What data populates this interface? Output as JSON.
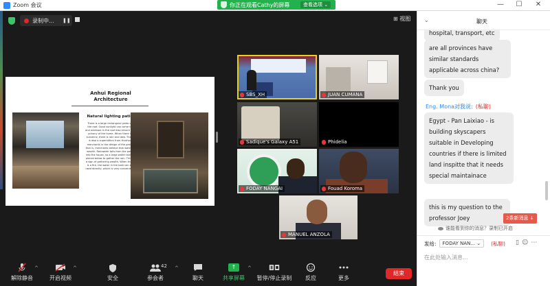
{
  "window": {
    "title": "Zoom 会议",
    "minimize": "—",
    "maximize": "☐",
    "close": "✕"
  },
  "share_banner": {
    "text": "你正在观看Cathy的屏幕",
    "view_options": "查看选项 ⌄"
  },
  "recording": {
    "label": "录制中...",
    "pause": "❚❚",
    "stop": "■"
  },
  "view_button": "⊞ 视图",
  "slide": {
    "title": "Anhui Regional Architecture",
    "subtitle": "Natural lighting patio",
    "body": "There is a large rectangular patio on the roof. Good sunlight can come in, and windows in the roof also ensure the privacy of the home. When there is sunshine, there is rain and dew. There is also a superstition from Huizhou merchants in the design of the patio, that is, merchants believe that water is wealth. Rainwater falls from the patio into the house, so a large water tank is placed below to gather the rain. This is a sign of gathering wealth. When there is a fire, the water in the tank can be used directly, which is very convenient."
  },
  "participants": [
    {
      "name": "SBS_XH",
      "muted": true,
      "active": true
    },
    {
      "name": "JUAN CUMANA",
      "muted": true,
      "active": false
    },
    {
      "name": "Sadique's Galaxy A51",
      "muted": true,
      "active": false
    },
    {
      "name": "Phidelia",
      "muted": true,
      "active": false
    },
    {
      "name": "FODAY NANGAI",
      "muted": true,
      "active": false
    },
    {
      "name": "Fouad Koroma",
      "muted": true,
      "active": false
    },
    {
      "name": "MANUEL ANZOLA",
      "muted": true,
      "active": false
    }
  ],
  "toolbar": {
    "unmute": "解除静音",
    "start_video": "开启视频",
    "security": "安全",
    "participants": "参会者",
    "participants_count": "42",
    "chat": "聊天",
    "share_screen": "共享屏幕",
    "pause_recording": "暂停/停止录制",
    "reactions": "反应",
    "more": "更多",
    "end": "结束"
  },
  "chat": {
    "title": "聊天",
    "messages": [
      {
        "text": "hospital, transport, etc"
      },
      {
        "text": "are all provinces have similar standards applicable across china?"
      },
      {
        "text": "Thank you"
      },
      {
        "sender": "Eng. Mona对我说:",
        "private": "(私聊)"
      },
      {
        "text": "Egypt - Pan Laixiao - is building skyscapers suitable in Developing countries if there is limited land inspitte that it needs special maintainace"
      },
      {
        "text": "this is my question to the professor Joey"
      }
    ],
    "new_messages": "2条新消息 ↓",
    "notice": "谁能看到你的消息？录制已开启",
    "to_label": "发给:",
    "to_value": "FODAY NAN... ⌄",
    "to_private": "(私聊)",
    "input_placeholder": "在此处输入消息..."
  }
}
